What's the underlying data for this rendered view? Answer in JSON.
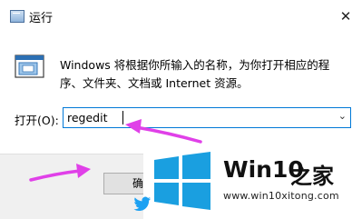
{
  "window": {
    "title": "运行",
    "close_glyph": "✕"
  },
  "dialog": {
    "description": "Windows 将根据你所输入的名称，为你打开相应的程序、文件夹、文档或 Internet 资源。",
    "open_label": "打开(O):",
    "command_value": "regedit",
    "dropdown_glyph": "⌄"
  },
  "buttons": {
    "ok_label": "确"
  },
  "watermark": {
    "brand_name": "Win10",
    "brand_suffix": "之家",
    "url": "www.win10xitong.com"
  },
  "colors": {
    "accent_border": "#0078d7",
    "annotation_arrow": "#e040e8",
    "logo_blue": "#1a9fe0"
  },
  "icons": {
    "app": "run-app-icon",
    "run": "run-dialog-icon",
    "close": "close-icon",
    "dropdown": "chevron-down-icon",
    "logo": "windows-logo-icon",
    "bird": "twitter-bird-icon"
  }
}
